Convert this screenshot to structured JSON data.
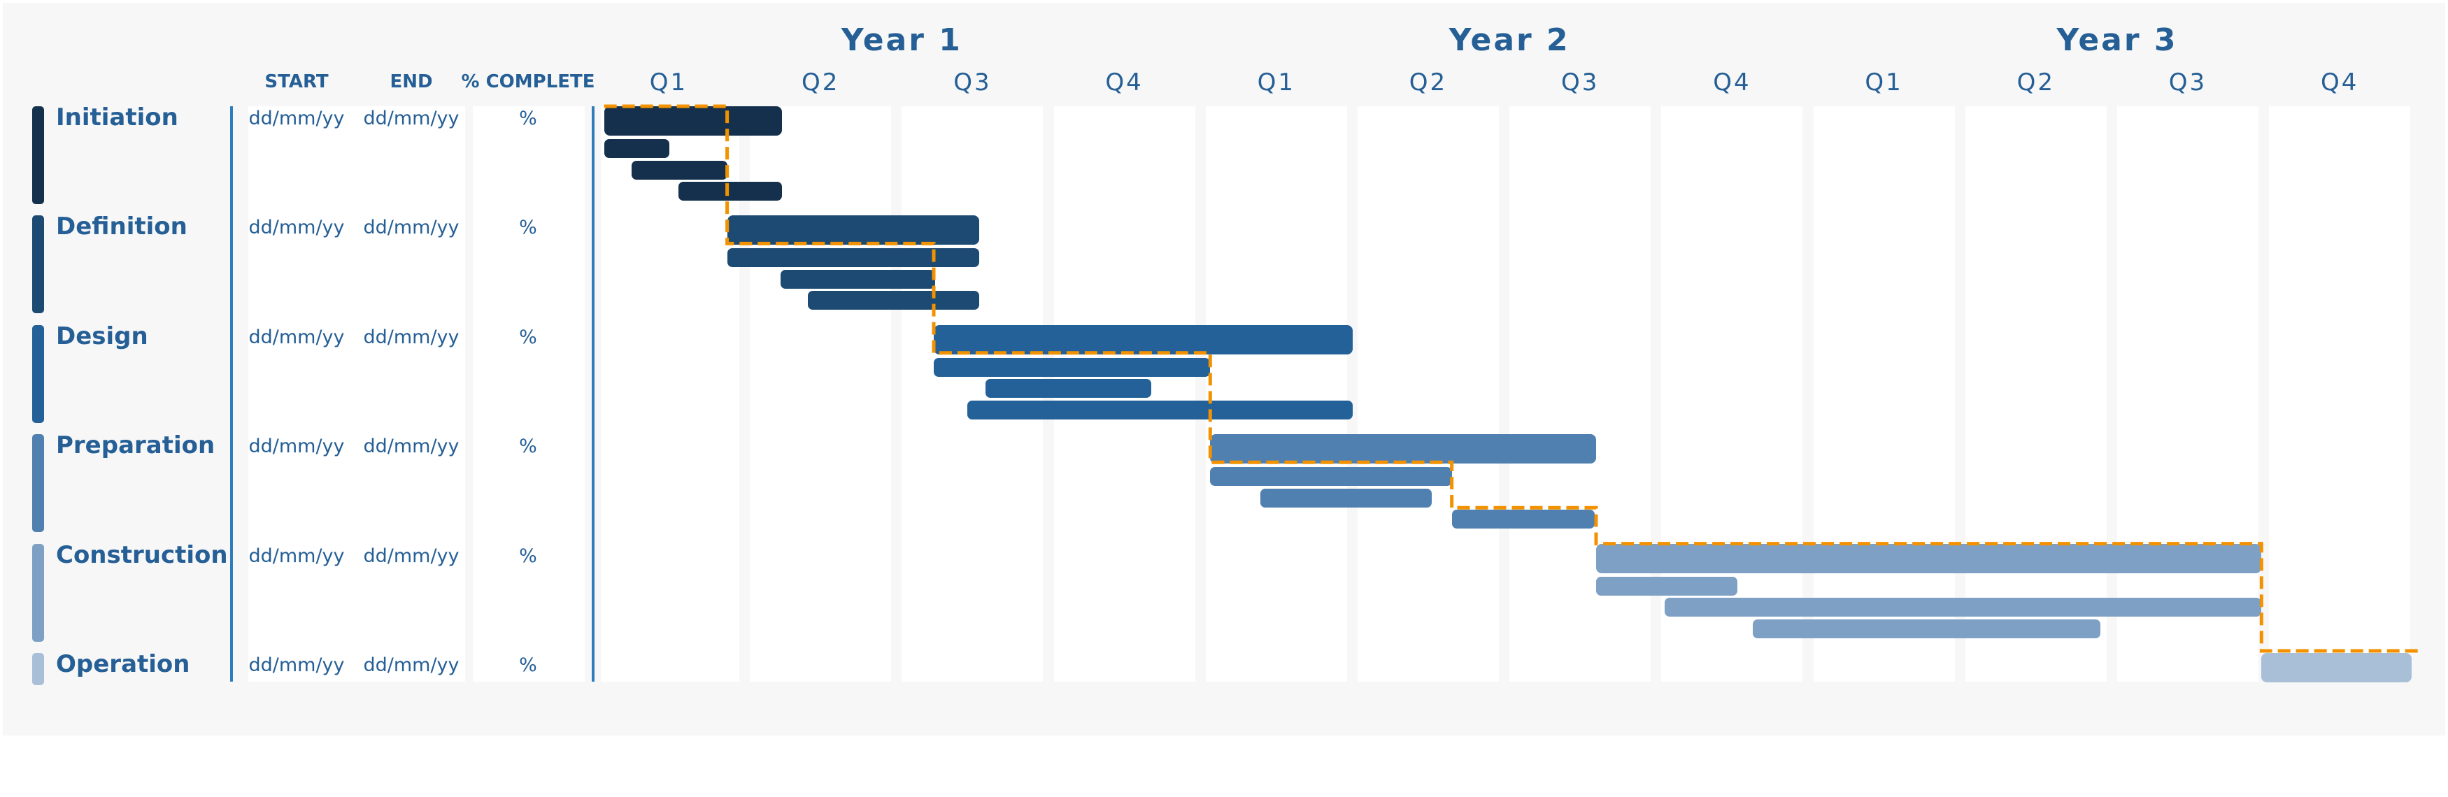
{
  "chart_data": {
    "type": "gantt",
    "title": "",
    "years": [
      "Year 1",
      "Year 2",
      "Year 3"
    ],
    "quarters": [
      "Q1",
      "Q2",
      "Q3",
      "Q4",
      "Q1",
      "Q2",
      "Q3",
      "Q4",
      "Q1",
      "Q2",
      "Q3",
      "Q4"
    ],
    "x_unit": "quarters from start of Year 1",
    "xlim": [
      0,
      12
    ],
    "columns": {
      "start": "START",
      "end": "END",
      "complete": "% COMPLETE"
    },
    "colors": {
      "text": "#255f96",
      "dependency": "#f39200",
      "divider": "#2f7cbb",
      "background": "#f7f7f7"
    },
    "phases": [
      {
        "name": "Initiation",
        "color": "#15304d",
        "start_date": "dd/mm/yy",
        "end_date": "dd/mm/yy",
        "complete": "%",
        "main": [
          0.04,
          1.21
        ],
        "tasks": [
          [
            0.04,
            0.47
          ],
          [
            0.22,
            0.85
          ],
          [
            0.53,
            1.21
          ]
        ]
      },
      {
        "name": "Definition",
        "color": "#1d4a73",
        "start_date": "dd/mm/yy",
        "end_date": "dd/mm/yy",
        "complete": "%",
        "main": [
          0.85,
          2.51
        ],
        "tasks": [
          [
            0.85,
            2.51
          ],
          [
            1.2,
            2.22
          ],
          [
            1.38,
            2.51
          ]
        ]
      },
      {
        "name": "Design",
        "color": "#236198",
        "start_date": "dd/mm/yy",
        "end_date": "dd/mm/yy",
        "complete": "%",
        "main": [
          2.21,
          4.97
        ],
        "tasks": [
          [
            2.21,
            4.03
          ],
          [
            2.55,
            3.64
          ],
          [
            2.43,
            4.97
          ]
        ]
      },
      {
        "name": "Preparation",
        "color": "#5080af",
        "start_date": "dd/mm/yy",
        "end_date": "dd/mm/yy",
        "complete": "%",
        "main": [
          4.03,
          6.57
        ],
        "tasks": [
          [
            4.03,
            5.62
          ],
          [
            4.36,
            5.49
          ],
          [
            5.62,
            6.56
          ]
        ]
      },
      {
        "name": "Construction",
        "color": "#7ea0c4",
        "start_date": "dd/mm/yy",
        "end_date": "dd/mm/yy",
        "complete": "%",
        "main": [
          6.57,
          10.95
        ],
        "tasks": [
          [
            6.57,
            7.5
          ],
          [
            7.02,
            10.95
          ],
          [
            7.6,
            9.89
          ]
        ]
      },
      {
        "name": "Operation",
        "color": "#a9bfd7",
        "start_date": "dd/mm/yy",
        "end_date": "dd/mm/yy",
        "complete": "%",
        "main": [
          10.95,
          11.94
        ],
        "tasks": []
      }
    ],
    "critical_path": [
      {
        "phase": 0,
        "from": 0.04,
        "to": 0.85
      },
      {
        "phase": 1,
        "from": 0.85,
        "to": 2.21
      },
      {
        "phase": 2,
        "from": 2.21,
        "to": 4.03
      },
      {
        "phase": 3,
        "from": 4.03,
        "to": 5.62
      },
      {
        "phase": 3,
        "from": 5.62,
        "to": 6.57,
        "level": "task3"
      },
      {
        "phase": 4,
        "from": 6.57,
        "to": 10.95
      },
      {
        "phase": 5,
        "from": 10.95,
        "to": 12
      }
    ]
  }
}
